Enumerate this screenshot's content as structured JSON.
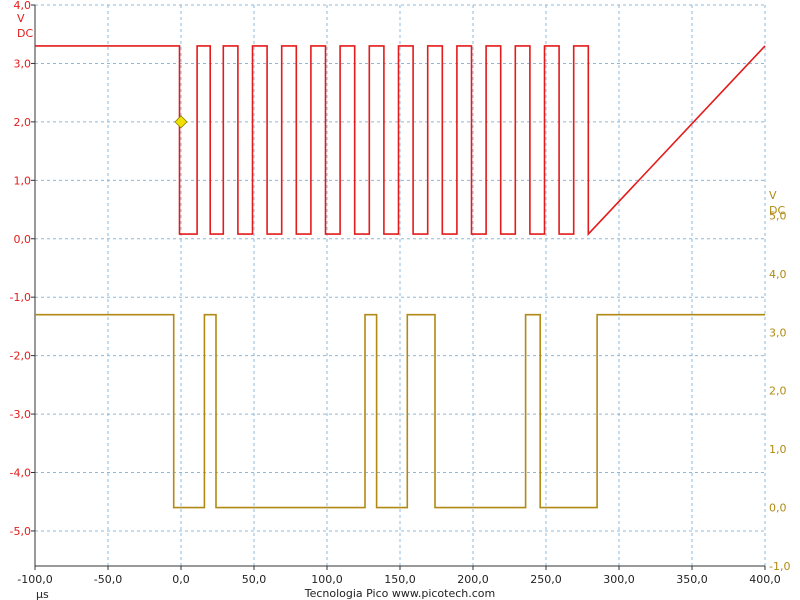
{
  "chart_data": {
    "type": "line",
    "x_unit": "µs",
    "xlim": [
      -100,
      400
    ],
    "x_ticks": [
      "-100,0",
      "-50,0",
      "0,0",
      "50,0",
      "100,0",
      "150,0",
      "200,0",
      "250,0",
      "300,0",
      "350,0",
      "400,0"
    ],
    "grid": true,
    "left_axis": {
      "unit": "V",
      "coupling": "DC",
      "ylim": [
        -5.6,
        4.0
      ],
      "color": "#e41b1b",
      "ticks": [
        "4,0",
        "3,0",
        "2,0",
        "1,0",
        "0,0",
        "-1,0",
        "-2,0",
        "-3,0",
        "-4,0",
        "-5,0"
      ]
    },
    "right_axis": {
      "unit": "V",
      "coupling": "DC",
      "ylim": [
        -1.0,
        8.6
      ],
      "color": "#b08a14",
      "ticks": [
        "5,0",
        "4,0",
        "3,0",
        "2,0",
        "1,0",
        "0,0",
        "-1,0"
      ]
    },
    "trigger_marker": {
      "x": 0.0,
      "y": 2.0,
      "color": "#f0e000"
    },
    "series": [
      {
        "axis": "left",
        "color": "#e41b1b",
        "high": 3.3,
        "low": 0.08,
        "x": [
          -100,
          -1,
          -1,
          11,
          11,
          20,
          20,
          29,
          29,
          39,
          39,
          49,
          49,
          59,
          59,
          69,
          69,
          79,
          79,
          89,
          89,
          99,
          99,
          109,
          109,
          119,
          119,
          129,
          129,
          139,
          139,
          149,
          149,
          159,
          159,
          169,
          169,
          179,
          179,
          189,
          189,
          199,
          199,
          209,
          209,
          219,
          219,
          229,
          229,
          239,
          239,
          249,
          249,
          259,
          259,
          269,
          269,
          279,
          279,
          400
        ],
        "y": [
          3.3,
          3.3,
          0.08,
          0.08,
          3.3,
          3.3,
          0.08,
          0.08,
          3.3,
          3.3,
          0.08,
          0.08,
          3.3,
          3.3,
          0.08,
          0.08,
          3.3,
          3.3,
          0.08,
          0.08,
          3.3,
          3.3,
          0.08,
          0.08,
          3.3,
          3.3,
          0.08,
          0.08,
          3.3,
          3.3,
          0.08,
          0.08,
          3.3,
          3.3,
          0.08,
          0.08,
          3.3,
          3.3,
          0.08,
          0.08,
          3.3,
          3.3,
          0.08,
          0.08,
          3.3,
          3.3,
          0.08,
          0.08,
          3.3,
          3.3,
          0.08,
          0.08,
          3.3,
          3.3,
          0.08,
          0.08,
          3.3,
          3.3,
          0.08,
          3.3
        ]
      },
      {
        "axis": "right",
        "color": "#b08a14",
        "high": 3.3,
        "low": 0.0,
        "x": [
          -100,
          -5,
          -5,
          16,
          16,
          24,
          24,
          126,
          126,
          134,
          134,
          155,
          155,
          174,
          174,
          236,
          236,
          246,
          246,
          285,
          285,
          400
        ],
        "y": [
          3.3,
          3.3,
          0.0,
          0.0,
          3.3,
          3.3,
          0.0,
          0.0,
          3.3,
          3.3,
          0.0,
          0.0,
          3.3,
          3.3,
          0.0,
          0.0,
          3.3,
          3.3,
          0.0,
          0.0,
          3.3,
          3.3
        ]
      }
    ]
  },
  "footer": {
    "unit_label": "µs",
    "brand": "Tecnologia Pico  www.picotech.com"
  }
}
